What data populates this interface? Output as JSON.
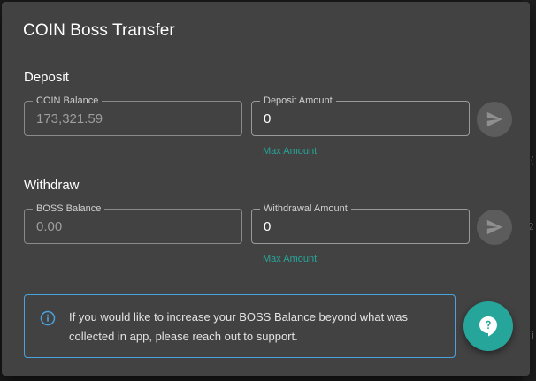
{
  "dialog": {
    "title": "COIN Boss Transfer"
  },
  "deposit": {
    "section_title": "Deposit",
    "balance_label": "COIN Balance",
    "balance_value": "173,321.59",
    "amount_label": "Deposit Amount",
    "amount_value": "0",
    "max_link": "Max Amount",
    "send_icon": "send-icon"
  },
  "withdraw": {
    "section_title": "Withdraw",
    "balance_label": "BOSS Balance",
    "balance_value": "0.00",
    "amount_label": "Withdrawal Amount",
    "amount_value": "0",
    "max_link": "Max Amount",
    "send_icon": "send-icon"
  },
  "info": {
    "icon": "info-icon",
    "text": "If you would like to increase your BOSS Balance beyond what was collected in app, please reach out to support."
  },
  "support_fab": {
    "icon": "help-chat-icon"
  },
  "colors": {
    "dialog_bg": "#424242",
    "accent": "#26a69a",
    "info_border": "#4aa3df",
    "disabled_button": "#5c5c5c"
  }
}
